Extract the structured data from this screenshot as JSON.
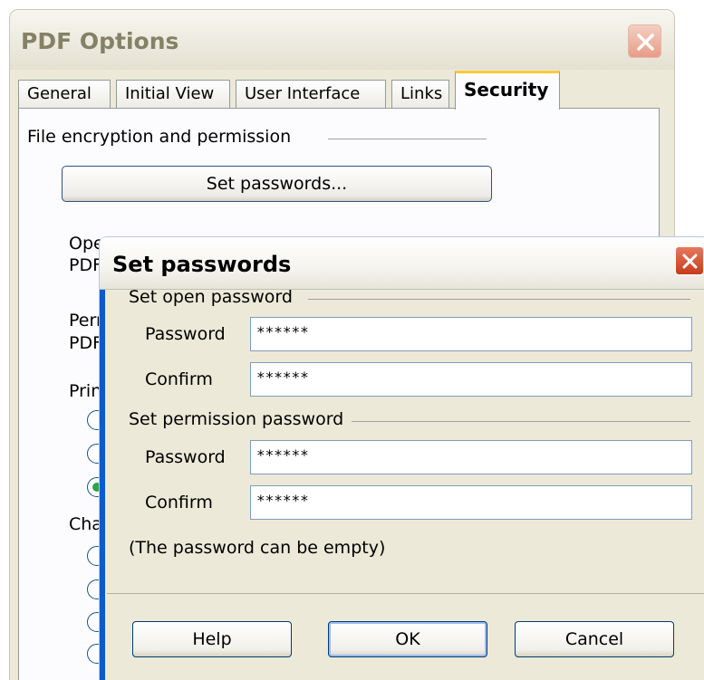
{
  "pdf_options": {
    "title": "PDF Options",
    "tabs": [
      {
        "label": "General"
      },
      {
        "label": "Initial View"
      },
      {
        "label": "User Interface"
      },
      {
        "label": "Links"
      },
      {
        "label": "Security"
      }
    ],
    "active_tab": "Security",
    "section_title": "File encryption and permission",
    "set_passwords_button": "Set passwords...",
    "partial_labels": {
      "open_line1": "Ope",
      "open_line2": "PDF",
      "perm_line1": "Perm",
      "perm_line2": "PDF",
      "print": "Print",
      "changes": "Char"
    }
  },
  "set_passwords": {
    "title": "Set passwords",
    "open_group": {
      "title": "Set open password",
      "password_label": "Password",
      "password_value": "******",
      "confirm_label": "Confirm",
      "confirm_value": "******"
    },
    "permission_group": {
      "title": "Set permission password",
      "password_label": "Password",
      "password_value": "******",
      "confirm_label": "Confirm",
      "confirm_value": "******"
    },
    "hint": "(The password can be empty)",
    "buttons": {
      "help": "Help",
      "ok": "OK",
      "cancel": "Cancel"
    }
  },
  "colors": {
    "dialog_face": "#ece9d8",
    "title_blue": "#0a5ad6",
    "close_red": "#c73c1b",
    "tab_highlight": "#ffc83c"
  }
}
